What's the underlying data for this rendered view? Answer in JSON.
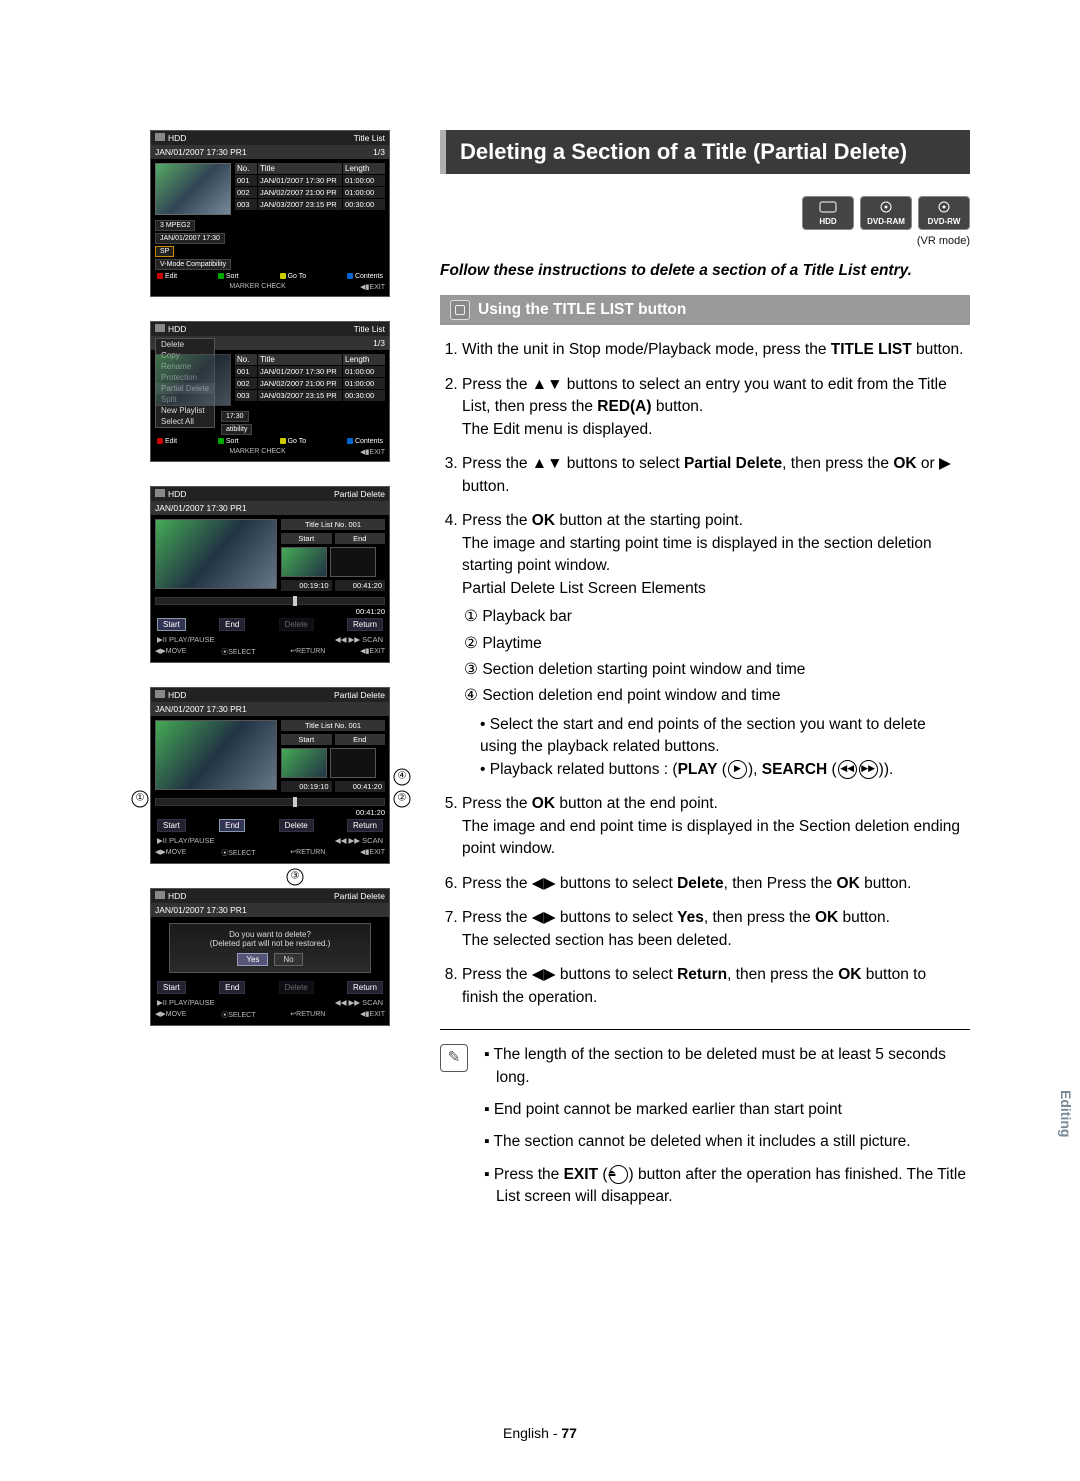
{
  "heading": "Deleting a Section of a Title (Partial Delete)",
  "compat": [
    "HDD",
    "DVD-RAM",
    "DVD-RW"
  ],
  "vr_note": "(VR mode)",
  "instruction": "Follow these instructions to delete a section of a Title List entry.",
  "using_title": "Using the TITLE LIST button",
  "steps": {
    "s1_a": "With the unit in Stop mode/Playback mode, press the ",
    "s1_b": "TITLE LIST",
    "s1_c": " button.",
    "s2_a": "Press the ▲▼ buttons to select an entry you want to edit from the Title List, then press the ",
    "s2_b": "RED(A)",
    "s2_c": " button.",
    "s2_d": "The Edit menu is displayed.",
    "s3_a": "Press the ▲▼ buttons to select ",
    "s3_b": "Partial Delete",
    "s3_c": ", then press the ",
    "s3_d": "OK",
    "s3_e": " or ▶ button.",
    "s4_a": "Press the ",
    "s4_b": "OK",
    "s4_c": " button at the starting point.",
    "s4_d": "The image and starting point time is displayed in the section deletion starting point window.",
    "s4_e": "Partial Delete List Screen Elements",
    "s4_list": {
      "i1": "Playback bar",
      "i2": "Playtime",
      "i3": "Section deletion starting point window and time",
      "i4": "Section deletion end point window and time"
    },
    "s4_sub1": "Select the start and end points of the section you want to delete using the playback related buttons.",
    "s4_sub2a": "Playback related buttons : (",
    "s4_sub2b": "PLAY",
    "s4_sub2c": ", ",
    "s4_sub2d": "SEARCH",
    "s4_sub2e": ").",
    "s5_a": "Press the ",
    "s5_b": "OK",
    "s5_c": " button at the end point.",
    "s5_d": "The image and end point time is displayed in the Section deletion ending point window.",
    "s6_a": "Press the ◀▶ buttons to select ",
    "s6_b": "Delete",
    "s6_c": ", then Press the ",
    "s6_d": "OK",
    "s6_e": " button.",
    "s7_a": "Press the ◀▶ buttons to select ",
    "s7_b": "Yes",
    "s7_c": ", then press the ",
    "s7_d": "OK",
    "s7_e": " button.",
    "s7_f": "The selected section has been deleted.",
    "s8_a": "Press the ◀▶ buttons to select ",
    "s8_b": "Return",
    "s8_c": ", then press the ",
    "s8_d": "OK",
    "s8_e": " button to finish the operation."
  },
  "notes": {
    "n1": "The length of the section to be deleted must be at least 5 seconds long.",
    "n2": "End point cannot be marked earlier than start point",
    "n3": "The section cannot be deleted when it includes a still picture.",
    "n4a": "Press the ",
    "n4b": "EXIT",
    "n4c": " button after the operation has finished. The Title List screen will disappear."
  },
  "footer": {
    "lang": "English",
    "page": "77"
  },
  "side_tab": "Editing",
  "screen_common": {
    "hdd": "HDD",
    "title_list": "Title List",
    "partial_delete": "Partial Delete",
    "date": "JAN/01/2007 17:30 PR1",
    "count": "1/3",
    "cols": {
      "no": "No.",
      "title": "Title",
      "length": "Length"
    },
    "rows": [
      {
        "no": "001",
        "title": "JAN/01/2007 17:30 PR",
        "len": "01:00:00"
      },
      {
        "no": "002",
        "title": "JAN/02/2007 21:00 PR",
        "len": "01:00:00"
      },
      {
        "no": "003",
        "title": "JAN/03/2007 23:15 PR",
        "len": "00:30:00"
      }
    ],
    "meta": {
      "l1": "3 MPEG2",
      "l2": "JAN/01/2007 17:30",
      "l3": "SP",
      "l4": "V-Mode Compatibility"
    },
    "foot": {
      "edit": "Edit",
      "sort": "Sort",
      "goto": "Go To",
      "contents": "Contents",
      "check": "CHECK",
      "exit": "EXIT",
      "marker": "MARKER",
      "move": "MOVE",
      "select": "SELECT",
      "return": "RETURN",
      "playpause": "▶II PLAY/PAUSE",
      "scan": "◀◀ ▶▶ SCAN"
    }
  },
  "edit_menu": [
    "Delete",
    "Copy",
    "Rename",
    "Protection",
    "Partial Delete",
    "Split",
    "New Playlist",
    "Select All"
  ],
  "edit_menu_extra": {
    "time": "17:30",
    "compat": "atibility"
  },
  "pd": {
    "tl_no": "Title List No. 001",
    "start": "Start",
    "end": "End",
    "t_start": "00:19:10",
    "t_end": "00:41:20",
    "total": "00:41:20",
    "btn_start": "Start",
    "btn_end": "End",
    "btn_delete": "Delete",
    "btn_return": "Return"
  },
  "dialog": {
    "q": "Do you want to delete?",
    "w": "(Deleted part will not be restored.)",
    "yes": "Yes",
    "no": "No"
  }
}
